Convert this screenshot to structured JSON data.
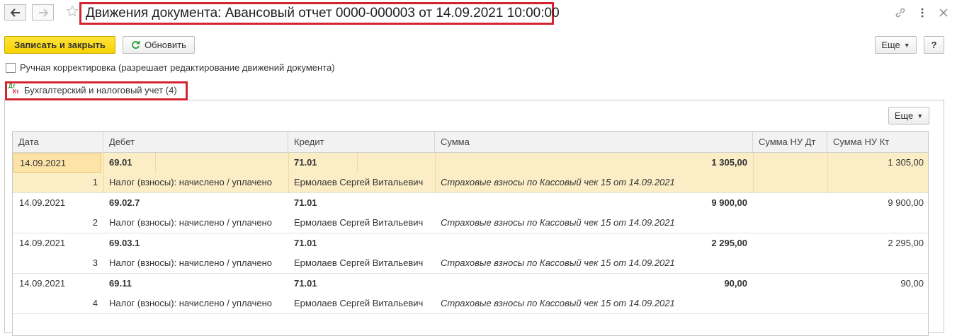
{
  "header": {
    "title": "Движения документа: Авансовый отчет 0000-000003 от 14.09.2021 10:00:00"
  },
  "toolbar": {
    "save_close": "Записать и закрыть",
    "refresh": "Обновить",
    "more": "Еще",
    "help": "?"
  },
  "manual_edit": {
    "checked": false,
    "label": "Ручная корректировка (разрешает редактирование движений документа)"
  },
  "tab": {
    "icon_top": "Дт",
    "icon_bottom": "Кт",
    "label": "Бухгалтерский и налоговый учет (4)"
  },
  "panel": {
    "more": "Еще"
  },
  "table": {
    "columns": [
      "Дата",
      "Дебет",
      "Кредит",
      "Сумма",
      "Сумма НУ Дт",
      "Сумма НУ Кт"
    ],
    "rows": [
      {
        "date": "14.09.2021",
        "num": "1",
        "debit": "69.01",
        "debit_sub": "Налог (взносы): начислено / уплачено",
        "credit": "71.01",
        "credit_sub": "Ермолаев Сергей Витальевич",
        "sum": "1 305,00",
        "content": "Страховые взносы по Кассовый чек 15 от 14.09.2021",
        "nu_dt": "",
        "nu_kt": "1 305,00"
      },
      {
        "date": "14.09.2021",
        "num": "2",
        "debit": "69.02.7",
        "debit_sub": "Налог (взносы): начислено / уплачено",
        "credit": "71.01",
        "credit_sub": "Ермолаев Сергей Витальевич",
        "sum": "9 900,00",
        "content": "Страховые взносы по Кассовый чек 15 от 14.09.2021",
        "nu_dt": "",
        "nu_kt": "9 900,00"
      },
      {
        "date": "14.09.2021",
        "num": "3",
        "debit": "69.03.1",
        "debit_sub": "Налог (взносы): начислено / уплачено",
        "credit": "71.01",
        "credit_sub": "Ермолаев Сергей Витальевич",
        "sum": "2 295,00",
        "content": "Страховые взносы по Кассовый чек 15 от 14.09.2021",
        "nu_dt": "",
        "nu_kt": "2 295,00"
      },
      {
        "date": "14.09.2021",
        "num": "4",
        "debit": "69.11",
        "debit_sub": "Налог (взносы): начислено / уплачено",
        "credit": "71.01",
        "credit_sub": "Ермолаев Сергей Витальевич",
        "sum": "90,00",
        "content": "Страховые взносы по Кассовый чек 15 от 14.09.2021",
        "nu_dt": "",
        "nu_kt": "90,00"
      }
    ]
  },
  "colors": {
    "accent_red": "#d32531",
    "primary_yellow": "#f6d200",
    "selected_row": "#fbeec6"
  },
  "icons": [
    "back-arrow-icon",
    "forward-arrow-icon",
    "star-icon",
    "link-icon",
    "more-vertical-icon",
    "close-icon",
    "refresh-icon",
    "dt-kt-icon"
  ]
}
